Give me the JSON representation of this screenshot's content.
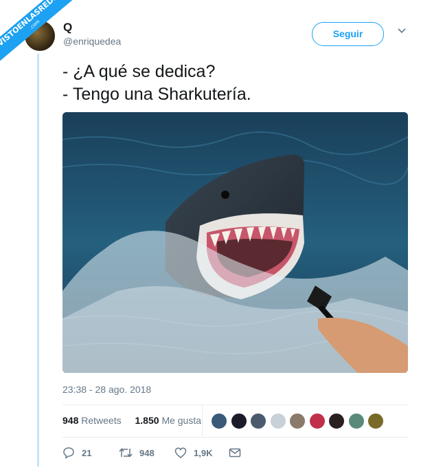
{
  "watermark": {
    "line1": "VISTOENLASREDES",
    "line2": ".com"
  },
  "header": {
    "display_name": "Q",
    "username": "@enriquedea",
    "follow_label": "Seguir"
  },
  "tweet": {
    "lines": [
      "- ¿A qué se dedica?",
      "- Tengo una Sharkutería."
    ],
    "timestamp": "23:38 - 28 ago. 2018"
  },
  "stats": {
    "retweets_count": "948",
    "retweets_label": "Retweets",
    "likes_count": "1.850",
    "likes_label": "Me gusta"
  },
  "likers": [
    {
      "color": "#3b5a7a"
    },
    {
      "color": "#1b1b2a"
    },
    {
      "color": "#4a5b6e"
    },
    {
      "color": "#c9d1d8"
    },
    {
      "color": "#8a7a6a"
    },
    {
      "color": "#c0304a"
    },
    {
      "color": "#2a2020"
    },
    {
      "color": "#5a8a7a"
    },
    {
      "color": "#7a6a2a"
    }
  ],
  "actions": {
    "reply_count": "21",
    "retweet_count": "948",
    "like_count": "1,9K"
  },
  "colors": {
    "accent": "#1da1f2",
    "muted": "#657786"
  }
}
